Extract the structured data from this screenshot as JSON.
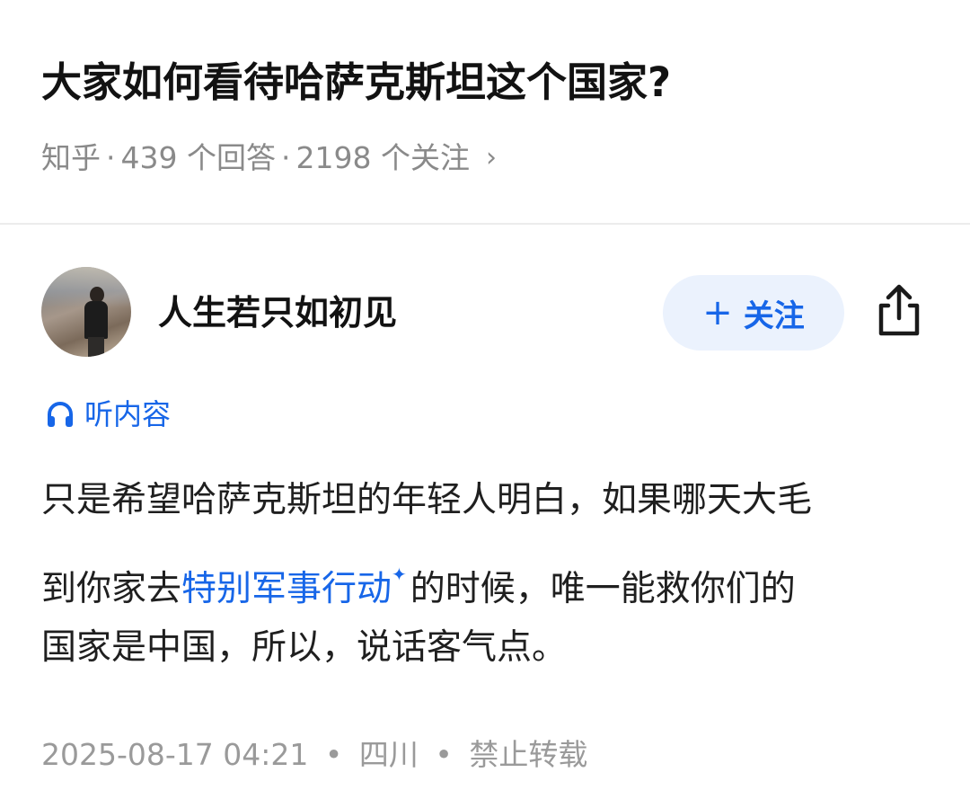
{
  "question": {
    "title": "大家如何看待哈萨克斯坦这个国家?",
    "source": "知乎",
    "answers": "439 个回答",
    "followers": "2198 个关注",
    "separator": "·",
    "chevron": "›"
  },
  "answer": {
    "author": {
      "name": "人生若只如初见",
      "avatar_icon": "user-avatar-photo"
    },
    "follow_button": {
      "plus": "+",
      "label": "关注",
      "bg_color": "#ebf2fd",
      "text_color": "#1766e8"
    },
    "share_icon": "share-icon",
    "listen_label": "听内容",
    "listen_icon": "headphones-icon",
    "content": {
      "line1": "只是希望哈萨克斯坦的年轻人明白，如果哪天大毛",
      "line2_before": "到你家去",
      "line2_link": "特别军事行动",
      "line2_spark": "✦",
      "line2_after": "的时候，唯一能救你们的",
      "line3": "国家是中国，所以，说话客气点。"
    },
    "meta": {
      "datetime": "2025-08-17 04:21",
      "location": "四川",
      "rights": "禁止转载",
      "separator": "•"
    }
  },
  "colors": {
    "accent": "#1766e8",
    "meta_text": "#8a8a8a",
    "divider": "#ececec"
  }
}
